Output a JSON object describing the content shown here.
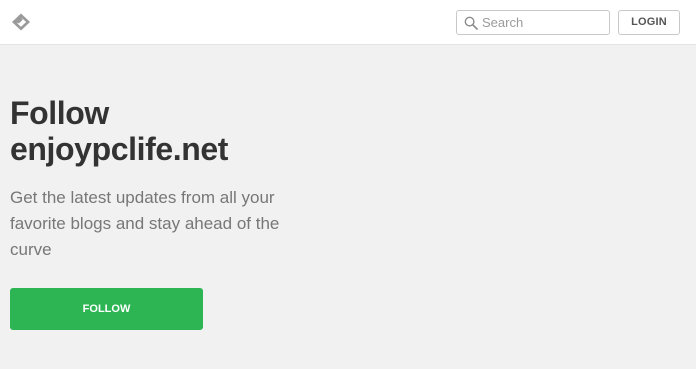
{
  "header": {
    "logo_icon": "feedly-logo-icon",
    "search": {
      "placeholder": "Search",
      "value": "",
      "icon": "search-icon"
    },
    "login_label": "LOGIN"
  },
  "hero": {
    "title_line1": "Follow",
    "title_line2": "enjoypclife.net",
    "subtitle": "Get the latest updates from all your favorite blogs and stay ahead of the curve",
    "follow_label": "FOLLOW"
  },
  "colors": {
    "accent": "#2db553",
    "page_background": "#f1f1f1",
    "header_background": "#ffffff"
  }
}
